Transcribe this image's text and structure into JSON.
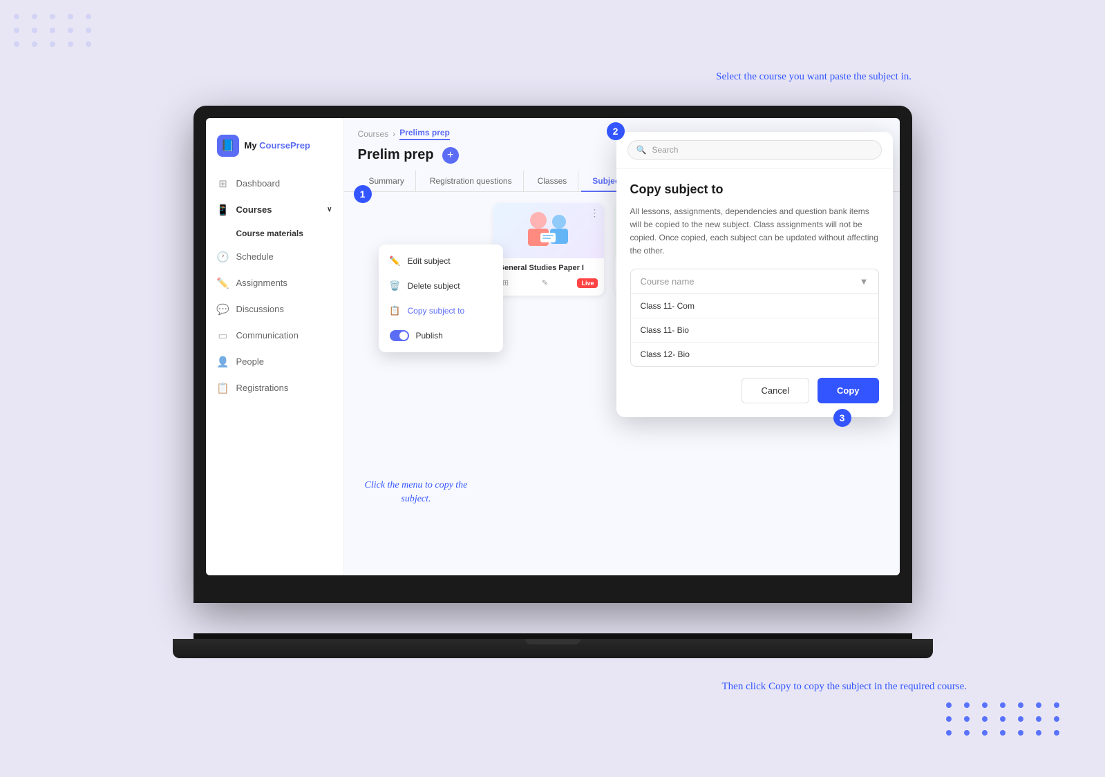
{
  "app": {
    "name": "My CoursePrep",
    "logo_emoji": "📘"
  },
  "sidebar": {
    "items": [
      {
        "id": "dashboard",
        "label": "Dashboard",
        "icon": "⊞"
      },
      {
        "id": "courses",
        "label": "Courses",
        "icon": "📱",
        "active": true,
        "arrow": "∨"
      },
      {
        "id": "course-materials",
        "label": "Course materials"
      },
      {
        "id": "schedule",
        "label": "Schedule",
        "icon": "🕐"
      },
      {
        "id": "assignments",
        "label": "Assignments",
        "icon": "✏️"
      },
      {
        "id": "discussions",
        "label": "Discussions",
        "icon": "💬"
      },
      {
        "id": "communication",
        "label": "Communication",
        "icon": "▭"
      },
      {
        "id": "people",
        "label": "People",
        "icon": "👤"
      },
      {
        "id": "registrations",
        "label": "Registrations",
        "icon": "📋"
      }
    ]
  },
  "breadcrumb": {
    "parent": "Courses",
    "current": "Prelims prep"
  },
  "page": {
    "title": "Prelim prep"
  },
  "tabs": [
    {
      "label": "Summary"
    },
    {
      "label": "Registration questions"
    },
    {
      "label": "Classes"
    },
    {
      "label": "Subjects",
      "active": true
    }
  ],
  "subject_card": {
    "title": "General Studies Paper I",
    "badge": "Live"
  },
  "context_menu": {
    "items": [
      {
        "icon": "✏️",
        "label": "Edit subject"
      },
      {
        "icon": "🗑️",
        "label": "Delete subject"
      },
      {
        "icon": "📋",
        "label": "Copy subject to",
        "highlighted": true
      },
      {
        "toggle": true,
        "label": "Publish"
      }
    ]
  },
  "modal": {
    "search_placeholder": "Search",
    "title": "Copy subject to",
    "description": "All lessons, assignments, dependencies and question bank items will be copied to the new subject.  Class assignments will not be copied. Once copied, each subject can be updated without affecting the other.",
    "dropdown_placeholder": "Course name",
    "options": [
      "Class 11- Com",
      "Class 11- Bio",
      "Class 12- Bio"
    ],
    "cancel_label": "Cancel",
    "copy_label": "Copy"
  },
  "annotations": {
    "step1_text": "Click the menu to copy the\nsubject.",
    "step2_text": "Select the course you want\npaste the subject in.",
    "step3_text": "Then click Copy to copy the\nsubject in the required course."
  },
  "steps": {
    "step1": "1",
    "step2": "2",
    "step3": "3"
  }
}
